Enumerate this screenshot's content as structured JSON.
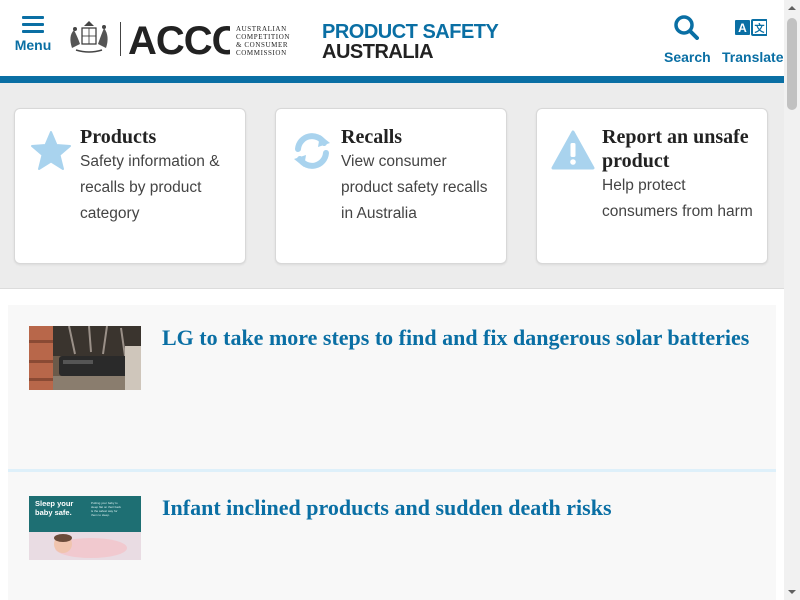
{
  "header": {
    "menu_label": "Menu",
    "accc_wordmark": "ACCC",
    "accc_subtitle_lines": [
      "AUSTRALIAN",
      "COMPETITION",
      "& CONSUMER",
      "COMMISSION"
    ],
    "site_title": "PRODUCT SAFETY",
    "site_subtitle": "AUSTRALIA",
    "search_label": "Search",
    "translate_label": "Translate",
    "translate_glyph_a": "A",
    "translate_glyph_b": "文"
  },
  "cards": [
    {
      "icon": "star-icon",
      "title": "Products",
      "description": "Safety information & recalls by product category"
    },
    {
      "icon": "refresh-icon",
      "title": "Recalls",
      "description": "View consumer product safety recalls in Australia"
    },
    {
      "icon": "warning-icon",
      "title": "Report an unsafe product",
      "description": "Help protect consumers from harm"
    }
  ],
  "news": [
    {
      "title": "LG to take more steps to find and fix dangerous solar batteries",
      "thumbnail": "solar-battery-photo"
    },
    {
      "title": "Infant inclined products and sudden death risks",
      "thumbnail": "sleeping-baby-photo",
      "thumb_caption": "Sleep your baby safe.",
      "thumb_small_text": "Putting your baby to sleep flat on their back is the safest way for them to sleep."
    }
  ],
  "colors": {
    "brand_blue": "#0a6fa4",
    "icon_light_blue": "#a9d3ee",
    "heading_dark": "#222222",
    "section_bg": "#ececec",
    "news_bg": "#f8f8f8"
  }
}
